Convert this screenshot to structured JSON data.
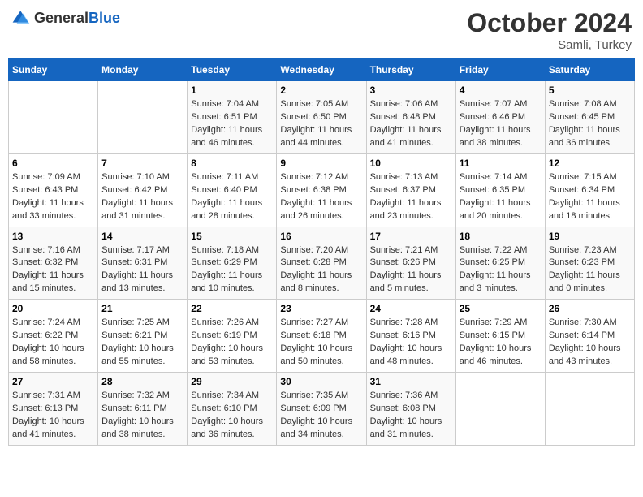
{
  "header": {
    "logo_general": "General",
    "logo_blue": "Blue",
    "month_title": "October 2024",
    "subtitle": "Samli, Turkey"
  },
  "days_of_week": [
    "Sunday",
    "Monday",
    "Tuesday",
    "Wednesday",
    "Thursday",
    "Friday",
    "Saturday"
  ],
  "weeks": [
    [
      {
        "day": "",
        "info": ""
      },
      {
        "day": "",
        "info": ""
      },
      {
        "day": "1",
        "info": "Sunrise: 7:04 AM\nSunset: 6:51 PM\nDaylight: 11 hours and 46 minutes."
      },
      {
        "day": "2",
        "info": "Sunrise: 7:05 AM\nSunset: 6:50 PM\nDaylight: 11 hours and 44 minutes."
      },
      {
        "day": "3",
        "info": "Sunrise: 7:06 AM\nSunset: 6:48 PM\nDaylight: 11 hours and 41 minutes."
      },
      {
        "day": "4",
        "info": "Sunrise: 7:07 AM\nSunset: 6:46 PM\nDaylight: 11 hours and 38 minutes."
      },
      {
        "day": "5",
        "info": "Sunrise: 7:08 AM\nSunset: 6:45 PM\nDaylight: 11 hours and 36 minutes."
      }
    ],
    [
      {
        "day": "6",
        "info": "Sunrise: 7:09 AM\nSunset: 6:43 PM\nDaylight: 11 hours and 33 minutes."
      },
      {
        "day": "7",
        "info": "Sunrise: 7:10 AM\nSunset: 6:42 PM\nDaylight: 11 hours and 31 minutes."
      },
      {
        "day": "8",
        "info": "Sunrise: 7:11 AM\nSunset: 6:40 PM\nDaylight: 11 hours and 28 minutes."
      },
      {
        "day": "9",
        "info": "Sunrise: 7:12 AM\nSunset: 6:38 PM\nDaylight: 11 hours and 26 minutes."
      },
      {
        "day": "10",
        "info": "Sunrise: 7:13 AM\nSunset: 6:37 PM\nDaylight: 11 hours and 23 minutes."
      },
      {
        "day": "11",
        "info": "Sunrise: 7:14 AM\nSunset: 6:35 PM\nDaylight: 11 hours and 20 minutes."
      },
      {
        "day": "12",
        "info": "Sunrise: 7:15 AM\nSunset: 6:34 PM\nDaylight: 11 hours and 18 minutes."
      }
    ],
    [
      {
        "day": "13",
        "info": "Sunrise: 7:16 AM\nSunset: 6:32 PM\nDaylight: 11 hours and 15 minutes."
      },
      {
        "day": "14",
        "info": "Sunrise: 7:17 AM\nSunset: 6:31 PM\nDaylight: 11 hours and 13 minutes."
      },
      {
        "day": "15",
        "info": "Sunrise: 7:18 AM\nSunset: 6:29 PM\nDaylight: 11 hours and 10 minutes."
      },
      {
        "day": "16",
        "info": "Sunrise: 7:20 AM\nSunset: 6:28 PM\nDaylight: 11 hours and 8 minutes."
      },
      {
        "day": "17",
        "info": "Sunrise: 7:21 AM\nSunset: 6:26 PM\nDaylight: 11 hours and 5 minutes."
      },
      {
        "day": "18",
        "info": "Sunrise: 7:22 AM\nSunset: 6:25 PM\nDaylight: 11 hours and 3 minutes."
      },
      {
        "day": "19",
        "info": "Sunrise: 7:23 AM\nSunset: 6:23 PM\nDaylight: 11 hours and 0 minutes."
      }
    ],
    [
      {
        "day": "20",
        "info": "Sunrise: 7:24 AM\nSunset: 6:22 PM\nDaylight: 10 hours and 58 minutes."
      },
      {
        "day": "21",
        "info": "Sunrise: 7:25 AM\nSunset: 6:21 PM\nDaylight: 10 hours and 55 minutes."
      },
      {
        "day": "22",
        "info": "Sunrise: 7:26 AM\nSunset: 6:19 PM\nDaylight: 10 hours and 53 minutes."
      },
      {
        "day": "23",
        "info": "Sunrise: 7:27 AM\nSunset: 6:18 PM\nDaylight: 10 hours and 50 minutes."
      },
      {
        "day": "24",
        "info": "Sunrise: 7:28 AM\nSunset: 6:16 PM\nDaylight: 10 hours and 48 minutes."
      },
      {
        "day": "25",
        "info": "Sunrise: 7:29 AM\nSunset: 6:15 PM\nDaylight: 10 hours and 46 minutes."
      },
      {
        "day": "26",
        "info": "Sunrise: 7:30 AM\nSunset: 6:14 PM\nDaylight: 10 hours and 43 minutes."
      }
    ],
    [
      {
        "day": "27",
        "info": "Sunrise: 7:31 AM\nSunset: 6:13 PM\nDaylight: 10 hours and 41 minutes."
      },
      {
        "day": "28",
        "info": "Sunrise: 7:32 AM\nSunset: 6:11 PM\nDaylight: 10 hours and 38 minutes."
      },
      {
        "day": "29",
        "info": "Sunrise: 7:34 AM\nSunset: 6:10 PM\nDaylight: 10 hours and 36 minutes."
      },
      {
        "day": "30",
        "info": "Sunrise: 7:35 AM\nSunset: 6:09 PM\nDaylight: 10 hours and 34 minutes."
      },
      {
        "day": "31",
        "info": "Sunrise: 7:36 AM\nSunset: 6:08 PM\nDaylight: 10 hours and 31 minutes."
      },
      {
        "day": "",
        "info": ""
      },
      {
        "day": "",
        "info": ""
      }
    ]
  ]
}
